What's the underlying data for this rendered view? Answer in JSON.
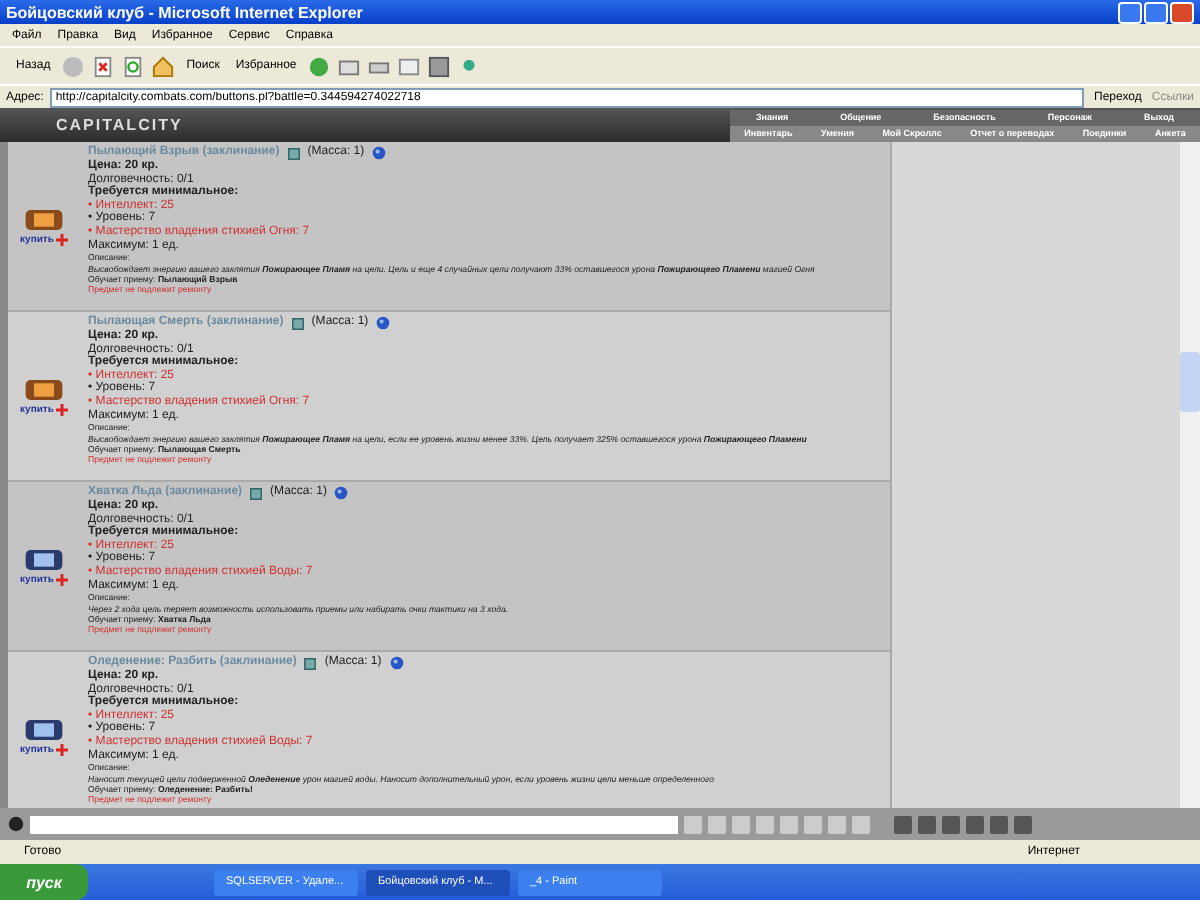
{
  "window": {
    "title": "Бойцовский клуб - Microsoft Internet Explorer"
  },
  "menu": [
    "Файл",
    "Правка",
    "Вид",
    "Избранное",
    "Сервис",
    "Справка"
  ],
  "toolbar": {
    "back": "Назад",
    "search": "Поиск",
    "favorites": "Избранное"
  },
  "address_bar": {
    "label": "Адрес:",
    "value": "http://capitalcity.combats.com/buttons.pl?battle=0.344594274022718",
    "go": "Переход",
    "links": "Ссылки"
  },
  "game_header": {
    "logo": "CAPITALCITY",
    "top_tabs": [
      "Знания",
      "Общение",
      "Безопасность",
      "Персонаж",
      "Выход"
    ],
    "bottom_tabs": [
      "Инвентарь",
      "Умения",
      "Мой Скроллс",
      "Отчет о переводах",
      "Поединки",
      "Анкета"
    ]
  },
  "items": [
    {
      "kind": "fire",
      "name": "Пылающий Взрыв (заклинание)",
      "mass": "(Масса: 1)",
      "price": "Цена: 20 кр.",
      "durability": "Долговечность: 0/1",
      "req_title": "Требуется минимальное:",
      "requirements": [
        {
          "text": "• Интеллект: 25",
          "met": false
        },
        {
          "text": "• Уровень: 7",
          "met": true
        },
        {
          "text": "• Мастерство владения стихией Огня: 7",
          "met": false
        }
      ],
      "max": "Максимум: 1 ед.",
      "desc_label": "Описание:",
      "description": "Высвобождает энергию вашего заклятия **Пожирающее Пламя** на цели. Цель и еще 4 случайных цели получают 33% оставшегося урона **Пожирающего Пламени** магией Огня",
      "teaches": "Обучает приему: **Пылающий Взрыв**",
      "repair": "Предмет не подлежит ремонту",
      "buy": "купить"
    },
    {
      "kind": "fire",
      "name": "Пылающая Смерть (заклинание)",
      "mass": "(Масса: 1)",
      "price": "Цена: 20 кр.",
      "durability": "Долговечность: 0/1",
      "req_title": "Требуется минимальное:",
      "requirements": [
        {
          "text": "• Интеллект: 25",
          "met": false
        },
        {
          "text": "• Уровень: 7",
          "met": true
        },
        {
          "text": "• Мастерство владения стихией Огня: 7",
          "met": false
        }
      ],
      "max": "Максимум: 1 ед.",
      "desc_label": "Описание:",
      "description": "Высвобождает энергию вашего заклятия **Пожирающее Пламя** на цели, если ее уровень жизни менее 33%. Цель получает 325% оставшегося урона **Пожирающего Пламени**",
      "teaches": "Обучает приему: **Пылающая Смерть**",
      "repair": "Предмет не подлежит ремонту",
      "buy": "купить"
    },
    {
      "kind": "water",
      "name": "Хватка Льда (заклинание)",
      "mass": "(Масса: 1)",
      "price": "Цена: 20 кр.",
      "durability": "Долговечность: 0/1",
      "req_title": "Требуется минимальное:",
      "requirements": [
        {
          "text": "• Интеллект: 25",
          "met": false
        },
        {
          "text": "• Уровень: 7",
          "met": true
        },
        {
          "text": "• Мастерство владения стихией Воды: 7",
          "met": false
        }
      ],
      "max": "Максимум: 1 ед.",
      "desc_label": "Описание:",
      "description": "Через 2 хода цель теряет возможность использовать приемы или набирать очки тактики на 3 хода.",
      "teaches": "Обучает приему: **Хватка Льда**",
      "repair": "Предмет не подлежит ремонту",
      "buy": "купить"
    },
    {
      "kind": "water",
      "name": "Оледенение: Разбить (заклинание)",
      "mass": "(Масса: 1)",
      "price": "Цена: 20 кр.",
      "durability": "Долговечность: 0/1",
      "req_title": "Требуется минимальное:",
      "requirements": [
        {
          "text": "• Интеллект: 25",
          "met": false
        },
        {
          "text": "• Уровень: 7",
          "met": true
        },
        {
          "text": "• Мастерство владения стихией Воды: 7",
          "met": false
        }
      ],
      "max": "Максимум: 1 ед.",
      "desc_label": "Описание:",
      "description": "Наносит текущей цели подверженной **Оледенение** урон магией воды. Наносит дополнительный урон, если уровень жизни цели меньше определенного",
      "teaches": "Обучает приему: **Оледенение: Разбить!**",
      "repair": "Предмет не подлежит ремонту",
      "buy": "купить"
    }
  ],
  "status_bar": {
    "text": "Готово",
    "zone": "Интернет"
  },
  "taskbar": {
    "start": "пуск",
    "tasks": [
      {
        "label": "SQLSERVER - Удале...",
        "selected": false
      },
      {
        "label": "Бойцовский клуб - M...",
        "selected": true
      },
      {
        "label": "_4 - Paint",
        "selected": false
      }
    ]
  }
}
